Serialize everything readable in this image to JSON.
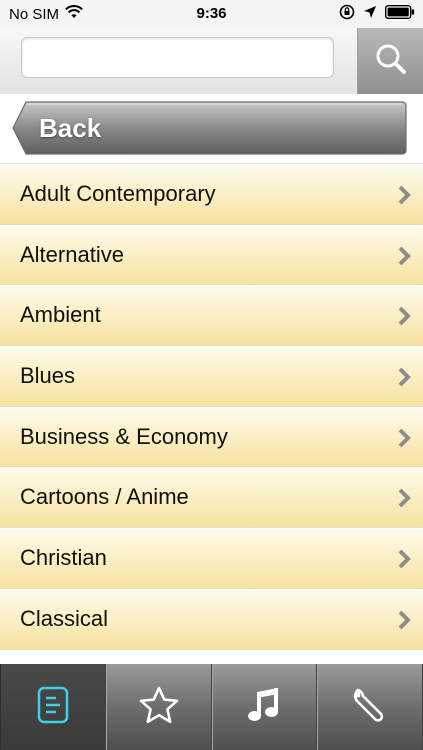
{
  "status_bar": {
    "carrier": "No SIM",
    "time": "9:36",
    "icons": [
      "wifi-icon",
      "rotation-lock-icon",
      "location-arrow-icon",
      "battery-icon"
    ]
  },
  "search": {
    "value": "",
    "placeholder": "",
    "button_icon": "search-icon"
  },
  "back": {
    "label": "Back"
  },
  "genres": [
    "Adult Contemporary",
    "Alternative",
    "Ambient",
    "Blues",
    "Business & Economy",
    "Cartoons / Anime",
    "Christian",
    "Classical"
  ],
  "tab_bar": {
    "tabs": [
      {
        "icon": "document-icon",
        "active": true
      },
      {
        "icon": "star-icon",
        "active": false
      },
      {
        "icon": "music-note-icon",
        "active": false
      },
      {
        "icon": "wrench-icon",
        "active": false
      }
    ]
  },
  "colors": {
    "list_top": "#fdfbee",
    "list_bottom": "#f6e1a0",
    "chevron": "#8c8c8c",
    "active_tab_icon": "#3fd0e6"
  }
}
